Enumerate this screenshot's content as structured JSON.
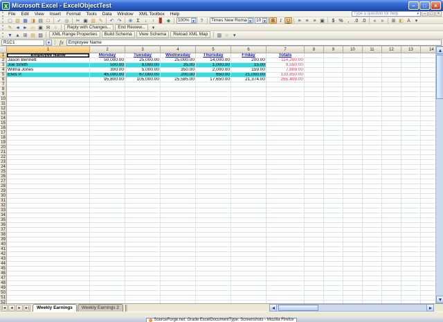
{
  "window": {
    "title": "Microsoft Excel - ExcelObjectTest",
    "icon_glyph": "X",
    "controls": [
      {
        "n": "minimize",
        "g": "–"
      },
      {
        "n": "restore",
        "g": "□"
      },
      {
        "n": "close",
        "g": "×"
      }
    ]
  },
  "menu": {
    "items": [
      "File",
      "Edit",
      "View",
      "Insert",
      "Format",
      "Tools",
      "Data",
      "Window",
      "XML Toolbox",
      "Help"
    ],
    "type_a_question": "Type a question for help",
    "window_controls": [
      {
        "n": "minimize-workbook",
        "g": "–"
      },
      {
        "n": "restore-workbook",
        "g": "□"
      },
      {
        "n": "close-workbook",
        "g": "×"
      }
    ]
  },
  "toolbar1": {
    "icons_a": [
      {
        "n": "new",
        "g": "▢",
        "c": "#667788"
      },
      {
        "n": "open",
        "g": "▧",
        "c": "#C8942A"
      },
      {
        "n": "save",
        "g": "▦",
        "c": "#2F5FAE"
      },
      {
        "n": "permission",
        "g": "◨",
        "c": "#D07828"
      },
      {
        "n": "print",
        "g": "▤",
        "c": "#556"
      },
      {
        "n": "print-preview",
        "g": "□",
        "c": "#556"
      },
      {
        "sep": true
      },
      {
        "n": "spelling",
        "g": "✓",
        "c": "#2F5FAE"
      },
      {
        "n": "research",
        "g": "◎",
        "c": "#3A8A5A"
      },
      {
        "sep": true
      },
      {
        "n": "cut",
        "g": "✂",
        "c": "#445"
      },
      {
        "n": "copy",
        "g": "▣",
        "c": "#445"
      },
      {
        "n": "paste",
        "g": "▥",
        "c": "#C8942A"
      },
      {
        "n": "format-painter",
        "g": "✎",
        "c": "#B08828"
      },
      {
        "sep": true
      },
      {
        "n": "undo",
        "g": "↶",
        "c": "#2F5FAE"
      },
      {
        "n": "redo",
        "g": "↷",
        "c": "#2F5FAE"
      },
      {
        "sep": true
      },
      {
        "n": "insert-hyperlink",
        "g": "⊕",
        "c": "#2F5FAE"
      },
      {
        "n": "autosum",
        "g": "Σ",
        "c": "#222"
      },
      {
        "n": "sort-ascending",
        "g": "↓",
        "c": "#2F5FAE"
      },
      {
        "n": "sort-descending",
        "g": "↑",
        "c": "#2F5FAE"
      },
      {
        "n": "chart-wizard",
        "g": "▊",
        "c": "#B03030"
      },
      {
        "n": "drawing",
        "g": "◆",
        "c": "#3A8A5A"
      },
      {
        "sep": true
      }
    ],
    "zoom": "100%",
    "icons_b": [
      {
        "n": "help",
        "g": "?",
        "c": "#2F5FAE"
      },
      {
        "sep": true
      }
    ],
    "font_name": "Times New Roman",
    "font_size": "10",
    "icons_fmt": [
      {
        "n": "bold",
        "g": "B",
        "fw": 1,
        "active": 1
      },
      {
        "n": "italic",
        "g": "I",
        "fi": 1
      },
      {
        "n": "underline",
        "g": "U",
        "fu": 1,
        "active": 1
      },
      {
        "sep": true
      },
      {
        "n": "align-left",
        "g": "≡",
        "c": "#445"
      },
      {
        "n": "align-center",
        "g": "≡",
        "c": "#445"
      },
      {
        "n": "align-right",
        "g": "≡",
        "c": "#445"
      },
      {
        "n": "merge-and-center",
        "g": "▣",
        "c": "#445"
      },
      {
        "sep": true
      },
      {
        "n": "currency",
        "g": "$",
        "c": "#222"
      },
      {
        "n": "percent",
        "g": "%",
        "c": "#222"
      },
      {
        "n": "comma-style",
        "g": ",",
        "c": "#222"
      },
      {
        "n": "increase-decimal",
        "g": ".0",
        "c": "#222"
      },
      {
        "n": "decrease-decimal",
        "g": ".0",
        "c": "#222"
      },
      {
        "sep": true
      },
      {
        "n": "decrease-indent",
        "g": "«",
        "c": "#445"
      },
      {
        "n": "increase-indent",
        "g": "»",
        "c": "#445"
      },
      {
        "sep": true
      },
      {
        "n": "borders",
        "g": "⊞",
        "c": "#445"
      },
      {
        "n": "fill-color",
        "g": "◧",
        "c": "#C8B020"
      },
      {
        "n": "font-color",
        "g": "A",
        "c": "#B03030"
      },
      {
        "n": "toolbar-options",
        "g": "▾",
        "c": "#445"
      }
    ]
  },
  "toolbar2": {
    "icons_a": [
      {
        "n": "edit-comment",
        "g": "✎",
        "c": "#B08828"
      },
      {
        "n": "previous-comment",
        "g": "◄",
        "c": "#2F5FAE"
      },
      {
        "n": "next-comment",
        "g": "►",
        "c": "#2F5FAE"
      },
      {
        "n": "show-comment",
        "g": "▭",
        "c": "#C8942A"
      },
      {
        "n": "delete-comment",
        "g": "▣",
        "c": "#445"
      },
      {
        "n": "send-mail",
        "g": "✉",
        "c": "#445"
      },
      {
        "n": "update-file",
        "g": "○",
        "c": "#3A8A5A"
      },
      {
        "sep": true
      }
    ],
    "buttons": [
      "Reply with Changes...",
      "End Review..."
    ],
    "icons_b": [
      {
        "n": "reviewing-options",
        "g": "▾",
        "c": "#445"
      }
    ]
  },
  "toolbar3": {
    "icons_a": [
      {
        "n": "import-xml",
        "g": "▼",
        "c": "#2F5FAE"
      },
      {
        "n": "export-xml",
        "g": "▲",
        "c": "#2F5FAE"
      },
      {
        "n": "xml-map-properties",
        "g": "⊞",
        "c": "#445"
      },
      {
        "n": "edit-query",
        "g": "▤",
        "c": "#C8942A"
      },
      {
        "n": "xml-source",
        "g": "▨",
        "c": "#445"
      },
      {
        "sep": true
      }
    ],
    "buttons": [
      "XML Range Properties",
      "Build Schema",
      "View Schema",
      "Reload XML Map"
    ],
    "icons_b": [
      {
        "sep": true
      },
      {
        "n": "list-range",
        "g": "▥",
        "c": "#445"
      },
      {
        "n": "refresh-xml",
        "g": "○",
        "c": "#3A8A5A"
      },
      {
        "n": "xml-options",
        "g": "▾",
        "c": "#445"
      }
    ]
  },
  "formula_bar": {
    "name_box": "R1C1",
    "fx": "fx",
    "value": "Employee Name"
  },
  "grid": {
    "column_headers": [
      "1",
      "2",
      "3",
      "4",
      "5",
      "6",
      "7",
      "8",
      "9",
      "10",
      "11",
      "12",
      "13",
      "14"
    ],
    "row_count": 52,
    "selected_cell": "R1C1"
  },
  "sheet": {
    "headers": [
      "Employee Name",
      "Monday",
      "Tuesday",
      "Wednesday",
      "Thursday",
      "Friday",
      "Totals"
    ],
    "rows": [
      {
        "name": "Jason Bennett",
        "values": [
          "50,000.00",
          "25,000.00",
          "25,000.00",
          "14,000.00",
          "200.00"
        ],
        "total": "114,200.00",
        "highlight": false
      },
      {
        "name": "Joe Smith",
        "values": [
          "500.00",
          "8,000.00",
          "35.00",
          "1,000.00",
          "15.00"
        ],
        "total": "9,550.00",
        "highlight": true
      },
      {
        "name": "Wilma Jones",
        "values": [
          "300.00",
          "5,000.00",
          "350.00",
          "2,000.00",
          "159.00"
        ],
        "total": "7,809.00",
        "highlight": false
      },
      {
        "name": "Elvis P.",
        "values": [
          "45,000.00",
          "67,000.00",
          "200.00",
          "650.00",
          "21,000.00"
        ],
        "total": "133,850.00",
        "highlight": true
      }
    ],
    "totals_row": {
      "values": [
        "95,800.00",
        "105,000.00",
        "25,585.00",
        "17,650.00",
        "21,374.00"
      ],
      "total": "265,409.00"
    }
  },
  "tabs": {
    "nav": [
      {
        "n": "scroll-first-sheet",
        "g": "|◄"
      },
      {
        "n": "scroll-previous-sheet",
        "g": "◄"
      },
      {
        "n": "scroll-next-sheet",
        "g": "►"
      },
      {
        "n": "scroll-last-sheet",
        "g": "►|"
      }
    ],
    "items": [
      {
        "label": "Weekly Earnings",
        "active": true
      },
      {
        "label": "Weekly Earnings 2",
        "active": false
      }
    ]
  },
  "taskbar": {
    "button_text": "SourceForge.net: Grade ExcelDocumentType: Screenshots - Mozilla Firefox"
  },
  "colors": {
    "row_highlight": "#35DEDE",
    "totals_text": "#E83C50",
    "header_text": "#1515C8",
    "selection_header": "#F3C06A",
    "titlebar_blue": "#2A5FD0"
  }
}
